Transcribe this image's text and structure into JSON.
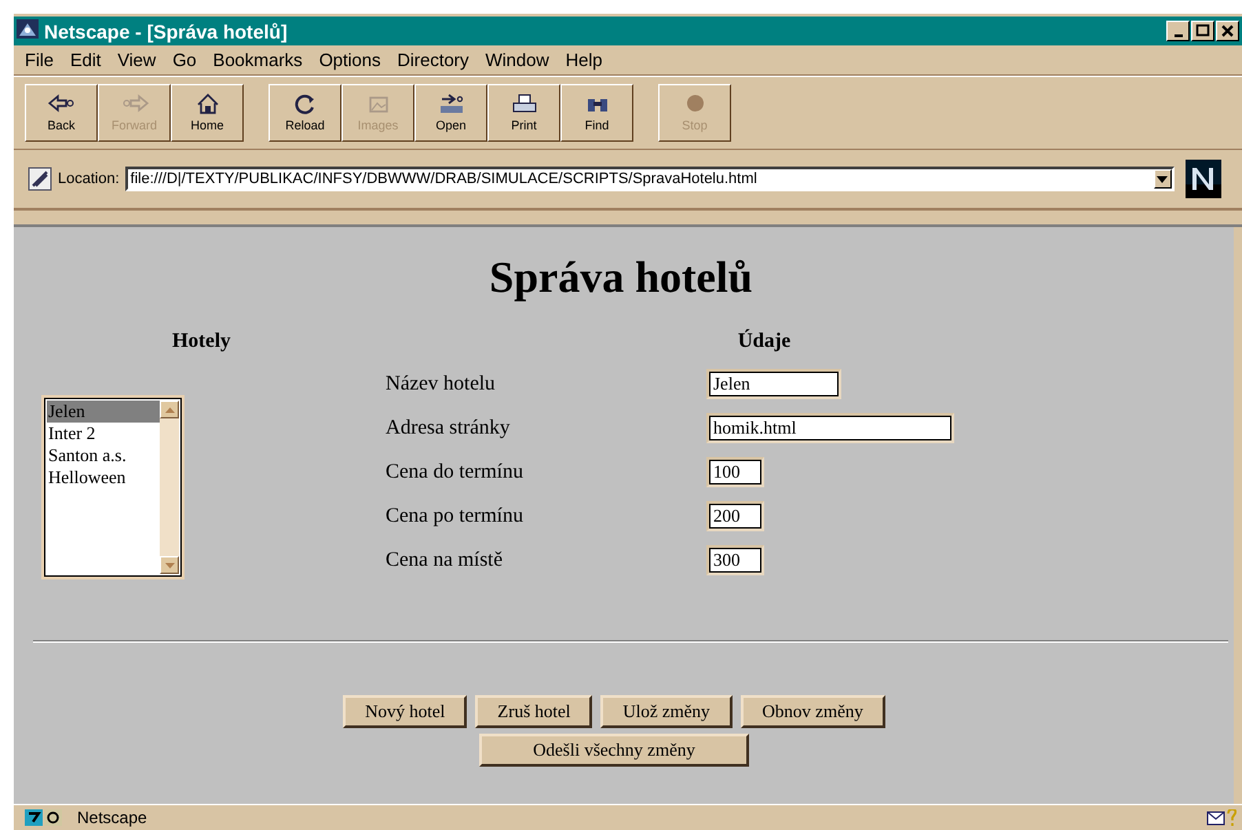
{
  "window": {
    "title": "Netscape - [Správa hotelů]"
  },
  "menu": [
    "File",
    "Edit",
    "View",
    "Go",
    "Bookmarks",
    "Options",
    "Directory",
    "Window",
    "Help"
  ],
  "toolbar": [
    {
      "label": "Back",
      "disabled": false
    },
    {
      "label": "Forward",
      "disabled": true
    },
    {
      "label": "Home",
      "disabled": false
    },
    {
      "label": "Reload",
      "disabled": false
    },
    {
      "label": "Images",
      "disabled": true
    },
    {
      "label": "Open",
      "disabled": false
    },
    {
      "label": "Print",
      "disabled": false
    },
    {
      "label": "Find",
      "disabled": false
    },
    {
      "label": "Stop",
      "disabled": true
    }
  ],
  "location": {
    "label": "Location:",
    "value": "file:///D|/TEXTY/PUBLIKAC/INFSY/DBWWW/DRAB/SIMULACE/SCRIPTS/SpravaHotelu.html"
  },
  "page": {
    "heading": "Správa hotelů",
    "hotels": {
      "heading": "Hotely",
      "items": [
        {
          "label": "Jelen",
          "selected": true
        },
        {
          "label": "Inter 2",
          "selected": false
        },
        {
          "label": "Santon a.s.",
          "selected": false
        },
        {
          "label": "Helloween",
          "selected": false
        }
      ]
    },
    "details": {
      "heading": "Údaje",
      "fields": [
        {
          "label": "Název hotelu",
          "value": "Jelen"
        },
        {
          "label": "Adresa stránky",
          "value": "homik.html"
        },
        {
          "label": "Cena do termínu",
          "value": "100"
        },
        {
          "label": "Cena po termínu",
          "value": "200"
        },
        {
          "label": "Cena na místě",
          "value": "300"
        }
      ]
    },
    "buttons": [
      "Nový hotel",
      "Zruš hotel",
      "Ulož změny",
      "Obnov změny"
    ],
    "submit": "Odešli všechny změny"
  },
  "status_bar": {
    "text": "Netscape"
  }
}
